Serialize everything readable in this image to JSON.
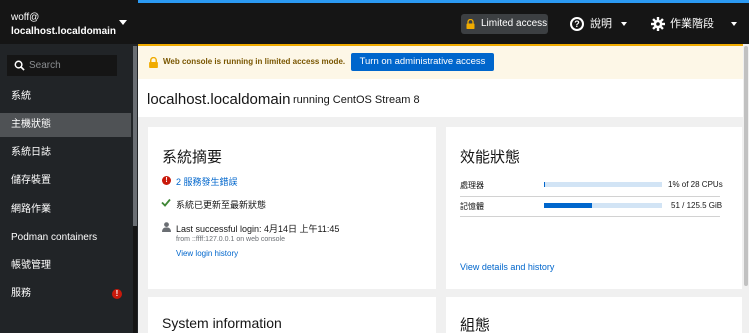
{
  "host_switcher": {
    "user": "woff@",
    "host": "localhost.localdomain"
  },
  "search": {
    "placeholder": "Search"
  },
  "nav": {
    "section_label": "系統",
    "items": [
      {
        "label": "主機狀態"
      },
      {
        "label": "系統日誌"
      },
      {
        "label": "儲存裝置"
      },
      {
        "label": "網路作業"
      },
      {
        "label": "Podman containers"
      },
      {
        "label": "帳號管理"
      },
      {
        "label": "服務",
        "badge": "!"
      }
    ]
  },
  "topbar": {
    "limited_access": "Limited access",
    "help": "說明",
    "session": "作業階段"
  },
  "alert": {
    "text": "Web console is running in limited access mode.",
    "button": "Turn on administrative access"
  },
  "header": {
    "hostname": "localhost.localdomain",
    "status": "running CentOS Stream 8"
  },
  "health_card": {
    "title": "系統摘要",
    "error_link": "2 服務發生錯誤",
    "updated": "系統已更新至最新狀態",
    "last_login": "Last successful login: 4月14日 上午11:45",
    "login_from": "from ::ffff:127.0.0.1 on web console",
    "view_login_history": "View login history"
  },
  "usage_card": {
    "title": "效能狀態",
    "rows": [
      {
        "label": "處理器",
        "value": "1% of 28 CPUs",
        "fraction": 0.01
      },
      {
        "label": "記憶體",
        "value": "51 / 125.5 GiB",
        "fraction": 0.4064
      }
    ],
    "details_link": "View details and history"
  },
  "system_info_card": {
    "title": "System information"
  },
  "config_card": {
    "title": "組態"
  },
  "colors": {
    "accent": "#0066cc",
    "sidebar_bg": "#212427",
    "alert_bg": "#fdf7e7",
    "warning": "#f0ab00",
    "danger": "#c9190b",
    "success": "#3e8635"
  }
}
